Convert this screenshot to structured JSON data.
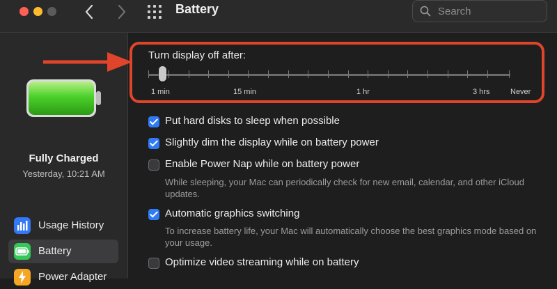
{
  "window": {
    "title": "Battery"
  },
  "search": {
    "placeholder": "Search"
  },
  "sidebar": {
    "status_title": "Fully Charged",
    "status_time": "Yesterday, 10:21 AM",
    "battery_level_percent": 100,
    "items": [
      {
        "label": "Usage History",
        "icon": "chart-icon",
        "color": "#3478f6"
      },
      {
        "label": "Battery",
        "icon": "battery-icon",
        "color": "#34c759",
        "selected": true
      },
      {
        "label": "Power Adapter",
        "icon": "power-adapter-icon",
        "color": "#f5a623"
      }
    ]
  },
  "display_sleep": {
    "title": "Turn display off after:",
    "labels": [
      "1 min",
      "15 min",
      "1 hr",
      "3 hrs",
      "Never"
    ],
    "selected_value": "1 min"
  },
  "options": [
    {
      "label": "Put hard disks to sleep when possible",
      "checked": true
    },
    {
      "label": "Slightly dim the display while on battery power",
      "checked": true
    },
    {
      "label": "Enable Power Nap while on battery power",
      "checked": false,
      "description": "While sleeping, your Mac can periodically check for new email, calendar, and other iCloud updates."
    },
    {
      "label": "Automatic graphics switching",
      "checked": true,
      "description": "To increase battery life, your Mac will automatically choose the best graphics mode based on your usage."
    },
    {
      "label": "Optimize video streaming while on battery",
      "checked": false
    }
  ],
  "colors": {
    "accent": "#2f7bf6",
    "highlight": "#e0452c",
    "battery_green": "#34c759"
  }
}
